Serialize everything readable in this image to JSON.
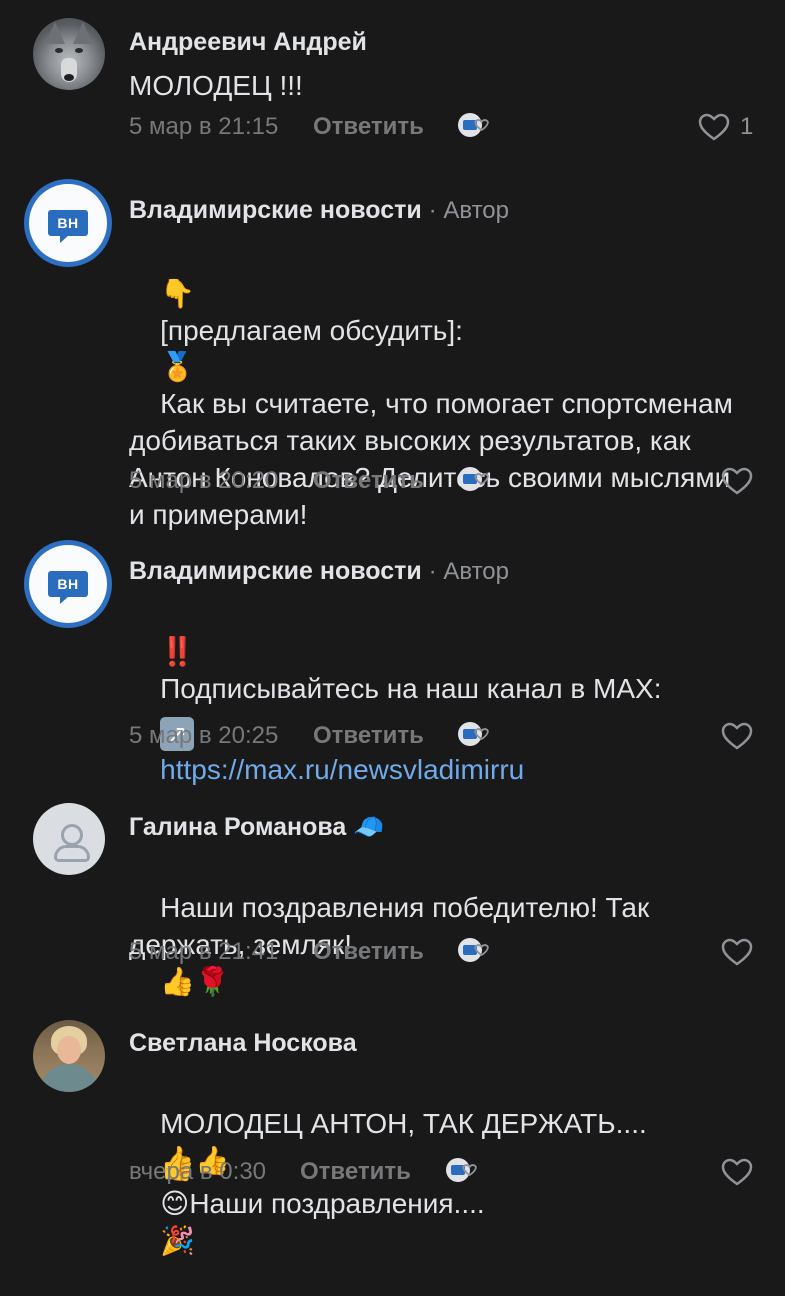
{
  "comments": [
    {
      "author": "Андреевич Андрей",
      "author_tag": "",
      "text": "МОЛОДЕЦ !!!",
      "date": "5 мар в 21:15",
      "reply_label": "Ответить",
      "like_count": "1"
    },
    {
      "author": "Владимирские новости",
      "author_tag": "· Автор",
      "text_line1_emoji": "👇",
      "text_line1": "[предлагаем обсудить]:",
      "text_line2_emoji": "🏅",
      "text_line2": "Как вы считаете, что помогает спортсменам добиваться таких высоких результатов, как Антон Коновалов? Делитесь своими мыслями и примерами!",
      "date": "5 мар в 20:20",
      "reply_label": "Ответить"
    },
    {
      "author": "Владимирские новости",
      "author_tag": "· Автор",
      "text_line1_emoji": "‼️",
      "text_line1": "Подписывайтесь на наш канал в MAX:",
      "link_emoji": "↗",
      "link": "https://max.ru/newsvladimirru",
      "date": "5 мар в 20:25",
      "reply_label": "Ответить"
    },
    {
      "author": "Галина Романова",
      "author_badge_emoji": "🧢",
      "text": "Наши поздравления победителю! Так держать, земляк!",
      "text_emoji": "👍🌹",
      "date": "5 мар в 21:41",
      "reply_label": "Ответить"
    },
    {
      "author": "Светлана Носкова",
      "text_line1": "МОЛОДЕЦ АНТОН, ТАК ДЕРЖАТЬ....",
      "text_line1_emoji": "👍👍",
      "text_line2_emoji_a": "👍",
      "text_line2_emoji_b": "😊",
      "text_line2": "Наши поздравления....",
      "text_line2_emoji_c": "🎉",
      "date": "вчера в 0:30",
      "reply_label": "Ответить"
    }
  ],
  "avatar_labels": {
    "vn": "ВН"
  },
  "icons": {
    "reaction": "reaction-icon",
    "like": "heart-icon"
  },
  "colors": {
    "background": "#19191a",
    "text": "#e1e3e6",
    "secondary": "#76787a",
    "link": "#71aaeb",
    "accent": "#2d6fc2"
  }
}
